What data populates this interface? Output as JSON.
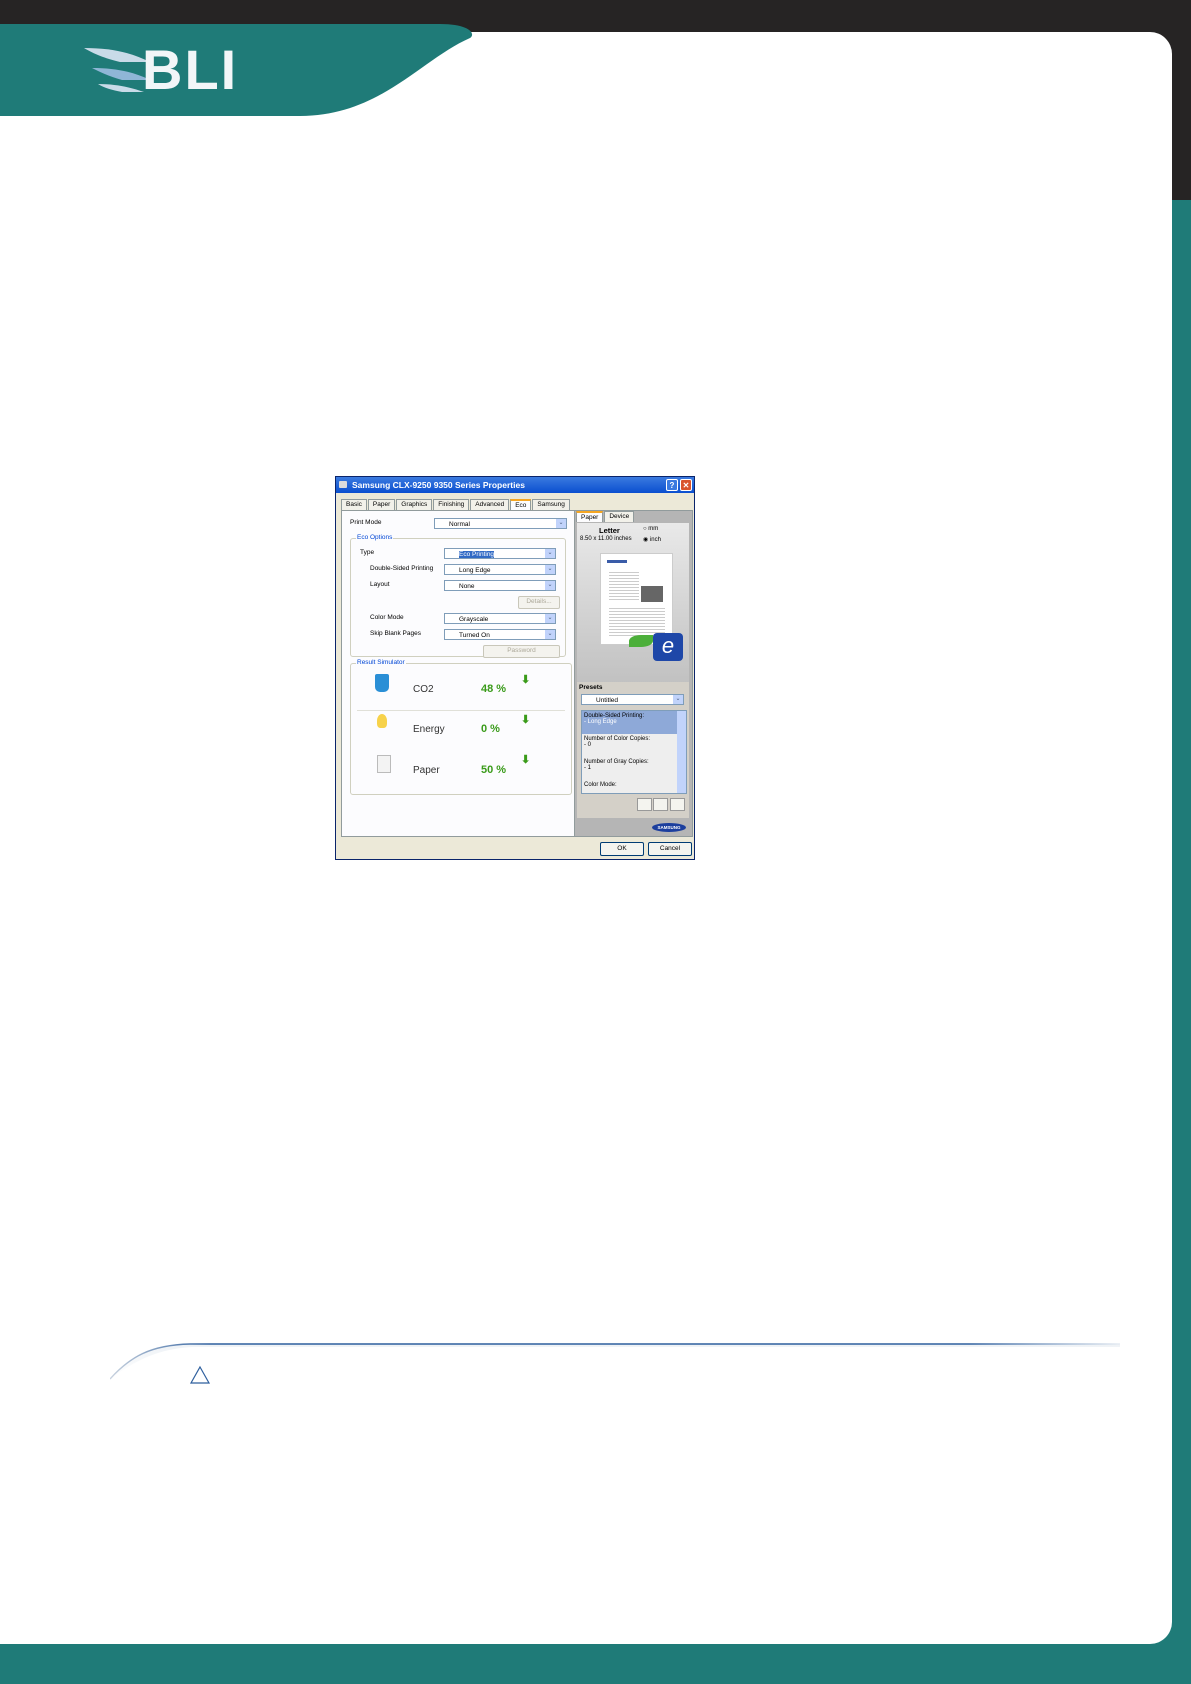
{
  "brand": {
    "logo_text": "BLI"
  },
  "colors": {
    "teal": "#1f7b78",
    "dark": "#262424",
    "rule": "#2e5f9e"
  },
  "dialog": {
    "title": "Samsung CLX-9250 9350 Series Properties",
    "tabs": [
      "Basic",
      "Paper",
      "Graphics",
      "Finishing",
      "Advanced",
      "Eco",
      "Samsung"
    ],
    "active_tab": "Eco",
    "print_mode": {
      "label": "Print Mode",
      "value": "Normal"
    },
    "eco_options": {
      "label": "Eco Options",
      "type": {
        "label": "Type",
        "value": "Eco Printing"
      },
      "double_sided": {
        "label": "Double-Sided Printing",
        "value": "Long Edge"
      },
      "layout": {
        "label": "Layout",
        "value": "None"
      },
      "details_button": "Details...",
      "color_mode": {
        "label": "Color Mode",
        "value": "Grayscale"
      },
      "skip_blank": {
        "label": "Skip Blank Pages",
        "value": "Turned On"
      },
      "password_button": "Password"
    },
    "simulator": {
      "label": "Result Simulator",
      "items": [
        {
          "name": "CO2",
          "value": "48 %",
          "icon": "co2-cup-icon"
        },
        {
          "name": "Energy",
          "value": "0 %",
          "icon": "lightbulb-icon"
        },
        {
          "name": "Paper",
          "value": "50 %",
          "icon": "paper-icon"
        }
      ]
    },
    "preview": {
      "tabs": [
        "Paper",
        "Device"
      ],
      "paper_name": "Letter",
      "paper_size": "8.50 x 11.00 inches",
      "unit_mm": "mm",
      "unit_inch": "inch",
      "selected_unit": "inch",
      "samsung_label": "SAMSUNG"
    },
    "presets": {
      "label": "Presets",
      "selected": "Untitled",
      "items": [
        {
          "title": "Double-Sided Printing:",
          "value": "- Long Edge"
        },
        {
          "title": "Number of Color Copies:",
          "value": "- 0"
        },
        {
          "title": "Number of Gray Copies:",
          "value": "- 1"
        },
        {
          "title": "Color Mode:",
          "value": ""
        }
      ]
    },
    "ok": "OK",
    "cancel": "Cancel"
  }
}
